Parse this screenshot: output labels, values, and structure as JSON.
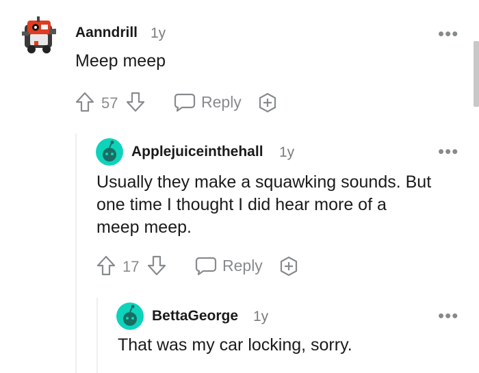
{
  "comments": [
    {
      "author": "Aanndrill",
      "age": "1y",
      "body": "Meep meep",
      "votes": "57",
      "reply_label": "Reply",
      "more_label": "•••"
    },
    {
      "author": "Applejuiceinthehall",
      "age": "1y",
      "body_lines": [
        "Usually they make a squawking sounds. But",
        "one time I thought I did hear more of a",
        "meep meep."
      ],
      "votes": "17",
      "reply_label": "Reply",
      "more_label": "•••"
    },
    {
      "author": "BettaGeorge",
      "age": "1y",
      "body": "That was my car locking, sorry.",
      "more_label": "•••"
    }
  ],
  "colors": {
    "text": "#1a1a1b",
    "muted": "#878a8c",
    "avatar_green": "#0dd3bb",
    "thread_line": "#edeff1"
  },
  "icons": [
    "robot-avatar-icon",
    "snoo-avatar-icon",
    "upvote-arrow-icon",
    "downvote-arrow-icon",
    "reply-bubble-icon",
    "award-icon",
    "more-options-icon"
  ]
}
